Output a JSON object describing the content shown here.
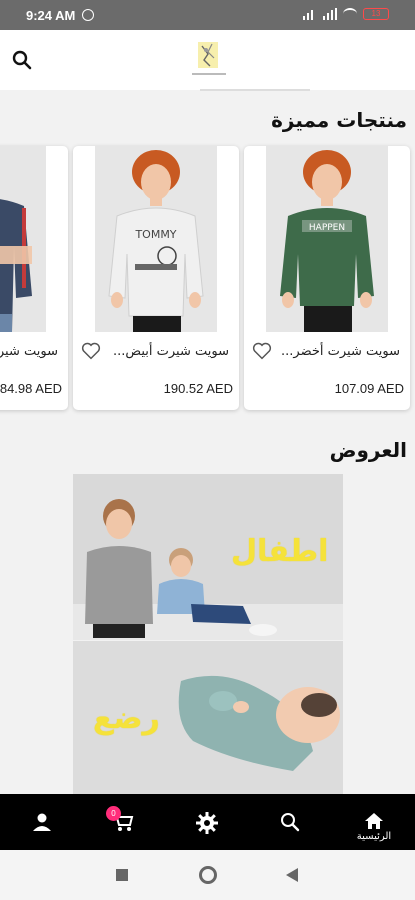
{
  "status_bar": {
    "time": "9:24 AM",
    "battery": "13"
  },
  "header": {
    "logo": "store-logo"
  },
  "featured": {
    "title": "منتجات مميزة",
    "products": [
      {
        "name": "سويت شيرت أخضر...",
        "price": "107.09 AED",
        "shirt_color": "#3e6b4a",
        "print": "HAPPEN"
      },
      {
        "name": "سويت شيرت أبيض...",
        "price": "190.52 AED",
        "shirt_color": "#f0f0f0",
        "print": "TOMMY"
      },
      {
        "name": "سويت شير",
        "price": "84.98 AED",
        "shirt_color": "#3a4a66",
        "print": ""
      }
    ]
  },
  "offers": {
    "title": "العروض",
    "banners": [
      {
        "label": "اطفال"
      },
      {
        "label": "رضع"
      }
    ]
  },
  "bottom_nav": {
    "items": [
      {
        "id": "home",
        "label": "الرئيسية",
        "icon": "home-icon",
        "active": true
      },
      {
        "id": "search",
        "label": "",
        "icon": "search-icon"
      },
      {
        "id": "settings",
        "label": "",
        "icon": "gear-icon"
      },
      {
        "id": "cart",
        "label": "",
        "icon": "cart-icon",
        "badge": "0"
      },
      {
        "id": "account",
        "label": "",
        "icon": "person-icon"
      }
    ]
  },
  "colors": {
    "accent_yellow": "#f5e23a",
    "badge_pink": "#ff2d7a",
    "nav_bg": "#000000"
  }
}
